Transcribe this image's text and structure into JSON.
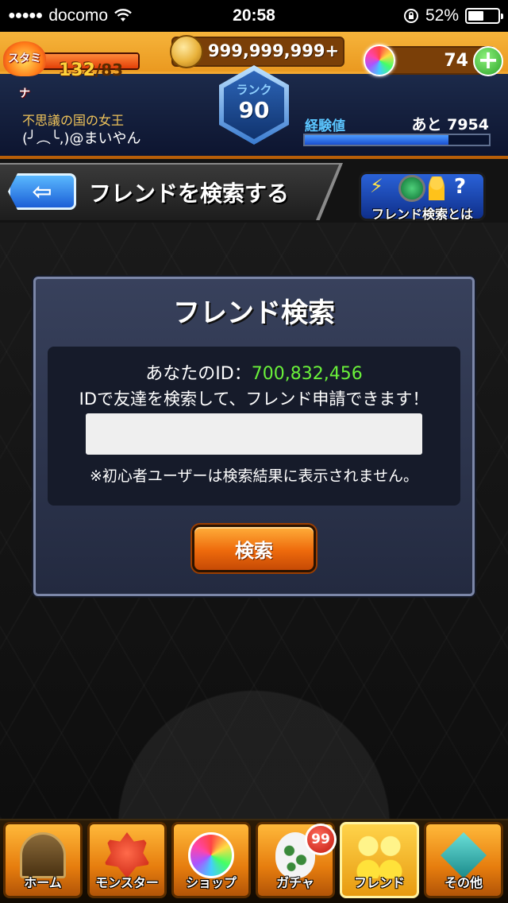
{
  "status_bar": {
    "signal_dots": "●●●●●",
    "carrier": "docomo",
    "time": "20:58",
    "battery_percent": "52%",
    "battery_level": 0.52
  },
  "header": {
    "stamina_label": "スタミナ",
    "stamina_current": "132",
    "stamina_max": "/83",
    "coins": "999,999,999+",
    "orbs": "74",
    "plus_symbol": "+",
    "rank_label": "ランク",
    "rank_value": "90",
    "player_title": "不思議の国の女王",
    "player_name": "(╯︵╰,)@まいやん",
    "exp_label": "経験値",
    "exp_remaining": "あと 7954",
    "exp_progress": 0.78
  },
  "title_bar": {
    "back_arrow": "⇦",
    "title": "フレンドを検索する",
    "help_label": "フレンド検索とは",
    "help_bolt": "⚡",
    "help_question": "?"
  },
  "dialog": {
    "title": "フレンド検索",
    "id_prefix": "あなたのID：",
    "id_value": "700,832,456",
    "description": "IDで友達を検索して、フレンド申請できます！",
    "input_value": "",
    "input_placeholder": "",
    "note": "※初心者ユーザーは検索結果に表示されません。",
    "search_button": "検索"
  },
  "bottom_nav": {
    "items": [
      {
        "label": "ホーム",
        "icon": "gate-icon"
      },
      {
        "label": "モンスター",
        "icon": "dragon-icon"
      },
      {
        "label": "ショップ",
        "icon": "orb-icon"
      },
      {
        "label": "ガチャ",
        "icon": "egg-icon"
      },
      {
        "label": "フレンド",
        "icon": "friends-icon"
      },
      {
        "label": "その他",
        "icon": "other-icon"
      }
    ],
    "gacha_badge": "99"
  },
  "colors": {
    "accent_orange": "#ee6a0c",
    "id_green": "#6af13a",
    "exp_blue": "#1a4fd0"
  }
}
